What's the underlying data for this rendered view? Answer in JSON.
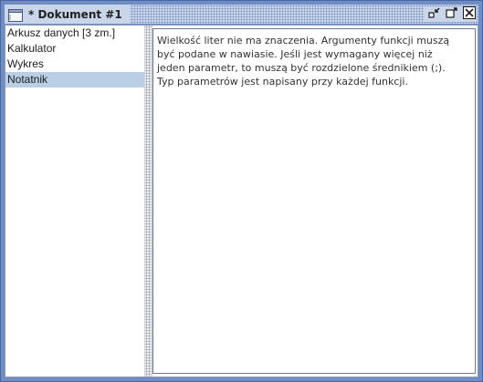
{
  "window": {
    "title": "* Dokument #1",
    "icons": {
      "document": "document-icon",
      "minimize": "minimize-icon",
      "maximize": "maximize-icon",
      "close": "close-icon"
    }
  },
  "sidebar": {
    "items": [
      {
        "label": "Arkusz danych [3 zm.]",
        "selected": false
      },
      {
        "label": "Kalkulator",
        "selected": false
      },
      {
        "label": "Wykres",
        "selected": false
      },
      {
        "label": "Notatnik",
        "selected": true
      }
    ]
  },
  "notes": {
    "lines": [
      "Wielkość liter nie ma znaczenia. Argumenty funkcji muszą",
      "być podane w nawiasie. Jeśli jest wymagany więcej niż",
      "jeden parametr, to muszą być rozdzielone średnikiem (;).",
      "Typ parametrów jest napisany przy każdej funkcji."
    ]
  },
  "colors": {
    "frame": "#6f8dc5",
    "selection": "#b8cfe5",
    "titlebar": "#c9d6ea"
  }
}
